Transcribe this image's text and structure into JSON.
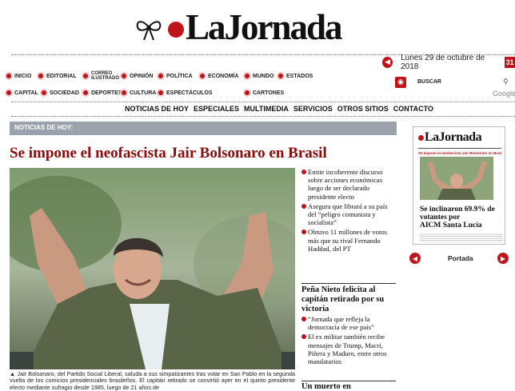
{
  "masthead": {
    "logo_text": "LaJornada"
  },
  "date": "Lunes 29 de octubre de 2018",
  "calendar_day": "31",
  "sections": [
    {
      "label": "INICIO"
    },
    {
      "label": "EDITORIAL"
    },
    {
      "label": "CORREO\nILUSTRADO"
    },
    {
      "label": "OPINIÓN"
    },
    {
      "label": "POLÍTICA"
    },
    {
      "label": "ECONOMÍA"
    },
    {
      "label": "MUNDO"
    },
    {
      "label": "ESTADOS"
    },
    {
      "label": "CAPITAL"
    },
    {
      "label": "SOCIEDAD"
    },
    {
      "label": "DEPORTES"
    },
    {
      "label": "CULTURA"
    },
    {
      "label": "ESPECTÁCULOS"
    },
    {
      "label": "CARTONES"
    }
  ],
  "tools": {
    "search_label": "BUSCAR",
    "google_label": "Google"
  },
  "menu": [
    "NOTICIAS DE HOY",
    "ESPECIALES",
    "MULTIMEDIA",
    "SERVICIOS",
    "OTROS SITIOS",
    "CONTACTO"
  ],
  "section_header": "NOTICIAS DE HOY:",
  "headline": "Se impone el neofascista Jair Bolsonaro en Brasil",
  "caption": "▲ Jair Bolsonaro, del Partido Social Liberal, saluda a sus simpatizantes tras votar en San Pablo en la segunda vuelta de los comicios presidenciales brasileños. El capitán retirado se convirtió ayer en el quinto presidente electo mediante sufragio desde 1985, luego de 21 años de",
  "bullets": [
    "Emite incoherente discurso sobre acciones económicas luego de ser declarado presidente electo",
    "Asegura que librará a su país del “peligro comunista y socialista”",
    "Obtuvo 11 millones de votos más que su rival Fernando Haddad, del PT"
  ],
  "story2": {
    "title": "Peña Nieto felicita al capitán retirado por su victoria",
    "bullets": [
      "“Jornada que refleja la democracia de ese país”",
      "El ex militar también recibe mensajes de Trump, Macri, Piñera y Maduro, entre otros mandatarios"
    ]
  },
  "story3": {
    "title": "Un muerto en"
  },
  "print_edition": {
    "logo_text": "LaJornada",
    "small_head": "Se impone el neofascista Jair Bolsonaro en Brasil",
    "big_head_1": "Se inclinaron 69.9% de votantes por",
    "big_head_2": "AICM Santa Lucía",
    "nav_label": "Portada"
  },
  "colors": {
    "brand_red": "#c0141b",
    "headline_red": "#8b0a0a",
    "bar_gray": "#9aa3ab"
  }
}
